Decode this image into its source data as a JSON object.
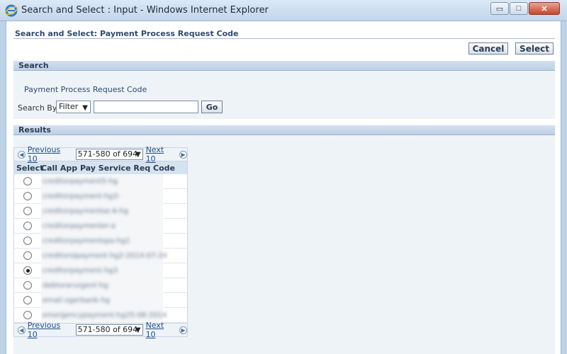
{
  "window": {
    "title": "Search and Select : Input - Windows Internet Explorer",
    "icon": "ie-icon",
    "minimize_glyph": "▭",
    "maximize_glyph": "□",
    "close_glyph": "✕"
  },
  "page": {
    "title": "Search and Select: Payment Process Request Code",
    "cancel_label": "Cancel",
    "select_label": "Select"
  },
  "search": {
    "header": "Search",
    "field_label": "Payment Process Request Code",
    "search_by_label": "Search By",
    "filter_value": "Filter",
    "input_value": "",
    "go_label": "Go"
  },
  "results": {
    "header": "Results",
    "previous_label": "Previous 10",
    "range_label": "571-580 of 694",
    "next_label": "Next 10",
    "columns": {
      "select": "Select",
      "code": "Call App Pay Service Req Code"
    },
    "rows": [
      {
        "code": "creditorpayment5-hg",
        "selected": false
      },
      {
        "code": "creditorpayment-hg3-",
        "selected": false
      },
      {
        "code": "creditorpaymentse-A-hg",
        "selected": false
      },
      {
        "code": "creditorpaymenter-a",
        "selected": false
      },
      {
        "code": "creditorpaymentspa-hg1",
        "selected": false
      },
      {
        "code": "creditorsipayment-hg2-2014-07-24",
        "selected": false
      },
      {
        "code": "creditorpayment-hg3",
        "selected": true
      },
      {
        "code": "debtorarurgent-hg",
        "selected": false
      },
      {
        "code": "email-ogerbank-hg",
        "selected": false
      },
      {
        "code": "emergencypayment-hg25-08-2014",
        "selected": false
      }
    ]
  },
  "colors": {
    "accent": "#2f4a6b",
    "link": "#1f4f8a",
    "section_header": "#bcd0e5"
  }
}
